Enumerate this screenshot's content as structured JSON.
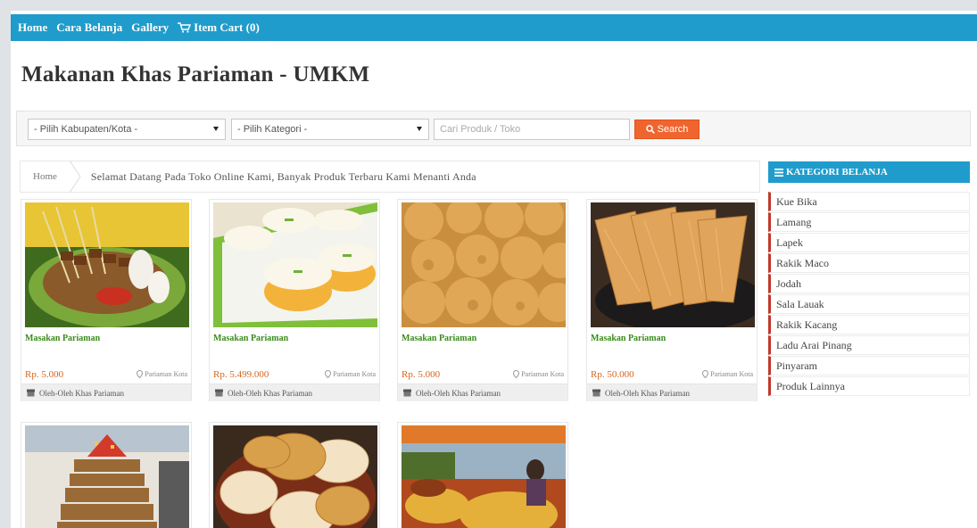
{
  "nav": {
    "home": "Home",
    "cara_belanja": "Cara Belanja",
    "gallery": "Gallery",
    "cart": "Item Cart (0)",
    "cart_icon": "shopping-cart-icon"
  },
  "page_title": "Makanan Khas Pariaman - UMKM",
  "filters": {
    "kabupaten": "- Pilih Kabupaten/Kota -",
    "kategori": "- Pilih Kategori -",
    "search_placeholder": "Cari Produk / Toko",
    "search_button": "Search"
  },
  "breadcrumb": {
    "home": "Home",
    "message": "Selamat Datang Pada Toko Online Kami, Banyak Produk Terbaru Kami Menanti Anda"
  },
  "products": [
    {
      "name": "Masakan Pariaman",
      "price": "Rp. 5.000",
      "location": "Pariaman Kota",
      "store": "Oleh-Oleh Khas Pariaman",
      "image": "sate"
    },
    {
      "name": "Masakan Pariaman",
      "price": "Rp. 5.499.000",
      "location": "Pariaman Kota",
      "store": "Oleh-Oleh Khas Pariaman",
      "image": "kue-lapis"
    },
    {
      "name": "Masakan Pariaman",
      "price": "Rp. 5.000",
      "location": "Pariaman Kota",
      "store": "Oleh-Oleh Khas Pariaman",
      "image": "kue-bolu"
    },
    {
      "name": "Masakan Pariaman",
      "price": "Rp. 50.000",
      "location": "Pariaman Kota",
      "store": "Oleh-Oleh Khas Pariaman",
      "image": "kerupuk"
    }
  ],
  "products_row2_images": [
    "tower-cakes",
    "pancakes",
    "food-stall"
  ],
  "sidebar": {
    "header": "KATEGORI BELANJA",
    "categories": [
      "Kue Bika",
      "Lamang",
      "Lapek",
      "Rakik Maco",
      "Jodah",
      "Sala Lauak",
      "Rakik Kacang",
      "Ladu Arai Pinang",
      "Pinyaram",
      "Produk Lainnya"
    ]
  },
  "colors": {
    "primary": "#1f9ccc",
    "search_button": "#f0652e",
    "product_name": "#3a8c1c",
    "price": "#d8641c",
    "category_border": "#c0392b"
  }
}
